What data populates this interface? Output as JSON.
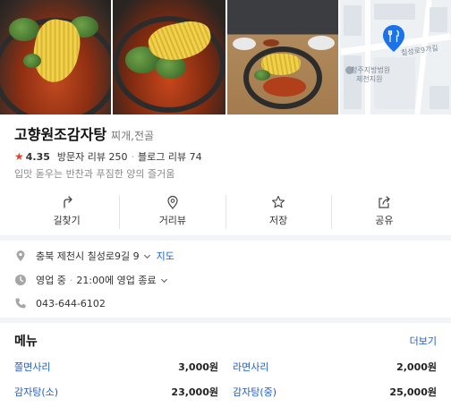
{
  "gallery": {
    "map": {
      "label_road": "칠성로9가길",
      "label_court_1": "청주지방법원",
      "label_court_2": "제천지원"
    }
  },
  "place": {
    "name": "고향원조감자탕",
    "category": "찌개,전골",
    "rating": "4.35",
    "visitor_reviews_label": "방문자 리뷰",
    "visitor_reviews_count": "250",
    "blog_reviews_label": "블로그 리뷰",
    "blog_reviews_count": "74",
    "description": "입맛 돋우는 반찬과 푸짐한 양의 즐거움"
  },
  "actions": [
    {
      "label": "길찾기",
      "icon": "directions-icon"
    },
    {
      "label": "거리뷰",
      "icon": "location-pin-icon"
    },
    {
      "label": "저장",
      "icon": "star-icon"
    },
    {
      "label": "공유",
      "icon": "share-icon"
    }
  ],
  "info": {
    "address": "충북 제천시 칠성로9길 9",
    "map_link": "지도",
    "hours_status": "영업 중",
    "hours_detail": "21:00에 영업 종료",
    "phone": "043-644-6102"
  },
  "menu": {
    "title": "메뉴",
    "more": "더보기",
    "items": [
      {
        "name": "쫄면사리",
        "price": "3,000원"
      },
      {
        "name": "라면사리",
        "price": "2,000원"
      },
      {
        "name": "감자탕(소)",
        "price": "23,000원"
      },
      {
        "name": "감자탕(중)",
        "price": "25,000원"
      }
    ]
  },
  "colors": {
    "accent_blue": "#1b5cd8",
    "star_red": "#e5432e",
    "map_pin_blue": "#1a73e8"
  }
}
